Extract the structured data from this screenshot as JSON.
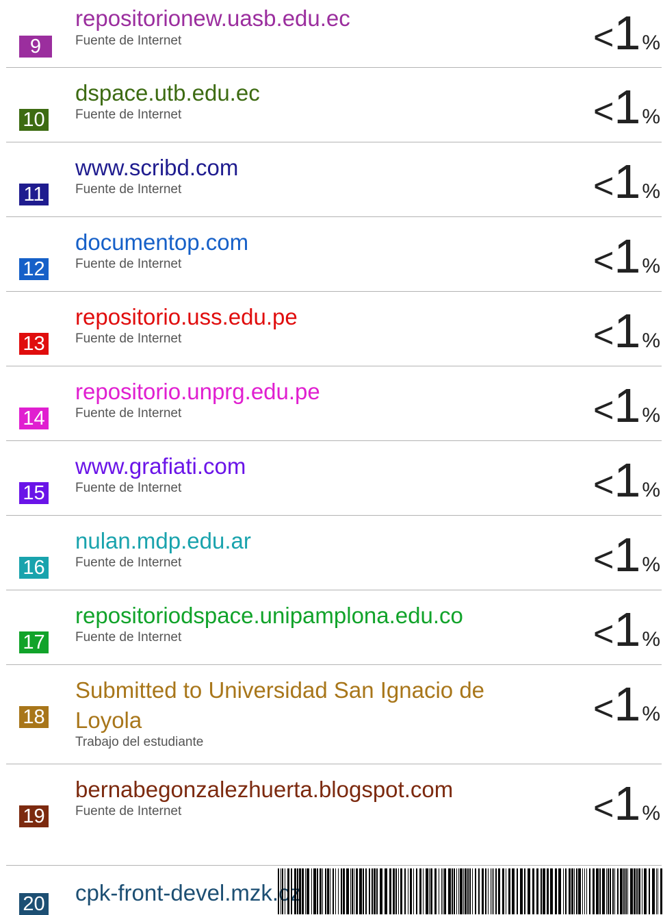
{
  "sources": [
    {
      "num": "9",
      "title": "repositorionew.uasb.edu.ec",
      "type": "Fuente de Internet",
      "color": "#9b2e9e",
      "pct_lt": "<",
      "pct_val": "1",
      "pct_sign": "%"
    },
    {
      "num": "10",
      "title": "dspace.utb.edu.ec",
      "type": "Fuente de Internet",
      "color": "#3d6b12",
      "pct_lt": "<",
      "pct_val": "1",
      "pct_sign": "%"
    },
    {
      "num": "11",
      "title": "www.scribd.com",
      "type": "Fuente de Internet",
      "color": "#1f1c8f",
      "pct_lt": "<",
      "pct_val": "1",
      "pct_sign": "%"
    },
    {
      "num": "12",
      "title": "documentop.com",
      "type": "Fuente de Internet",
      "color": "#1660c8",
      "pct_lt": "<",
      "pct_val": "1",
      "pct_sign": "%"
    },
    {
      "num": "13",
      "title": "repositorio.uss.edu.pe",
      "type": "Fuente de Internet",
      "color": "#e00d0d",
      "pct_lt": "<",
      "pct_val": "1",
      "pct_sign": "%"
    },
    {
      "num": "14",
      "title": "repositorio.unprg.edu.pe",
      "type": "Fuente de Internet",
      "color": "#e01fd0",
      "pct_lt": "<",
      "pct_val": "1",
      "pct_sign": "%"
    },
    {
      "num": "15",
      "title": "www.grafiati.com",
      "type": "Fuente de Internet",
      "color": "#6a14e8",
      "pct_lt": "<",
      "pct_val": "1",
      "pct_sign": "%"
    },
    {
      "num": "16",
      "title": "nulan.mdp.edu.ar",
      "type": "Fuente de Internet",
      "color": "#19a3ad",
      "pct_lt": "<",
      "pct_val": "1",
      "pct_sign": "%"
    },
    {
      "num": "17",
      "title": "repositoriodspace.unipamplona.edu.co",
      "type": "Fuente de Internet",
      "color": "#11a32a",
      "pct_lt": "<",
      "pct_val": "1",
      "pct_sign": "%"
    },
    {
      "num": "18",
      "title": "Submitted to Universidad San Ignacio de Loyola",
      "type": "Trabajo del estudiante",
      "color": "#a8761a",
      "pct_lt": "<",
      "pct_val": "1",
      "pct_sign": "%"
    },
    {
      "num": "19",
      "title": "bernabegonzalezhuerta.blogspot.com",
      "type": "Fuente de Internet",
      "color": "#7c2a0f",
      "pct_lt": "<",
      "pct_val": "1",
      "pct_sign": "%"
    },
    {
      "num": "20",
      "title": "cpk-front-devel.mzk.cz",
      "type": "",
      "color": "#1d4f73",
      "pct_lt": "",
      "pct_val": "",
      "pct_sign": ""
    }
  ]
}
